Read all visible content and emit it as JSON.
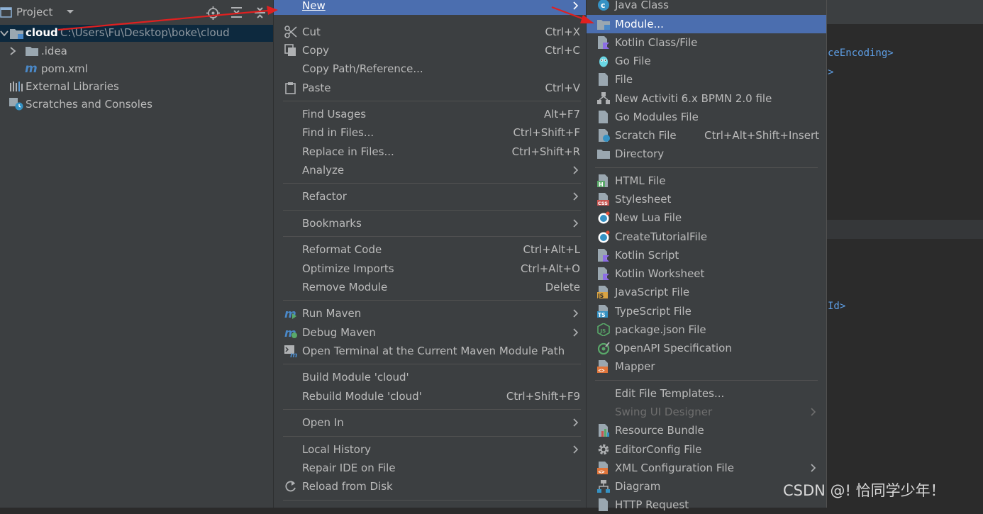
{
  "project_panel": {
    "title": "Project",
    "tree": {
      "root_name": "cloud",
      "root_path": "C:\\Users\\Fu\\Desktop\\boke\\cloud",
      "idea_folder": ".idea",
      "pom_file": "pom.xml",
      "external_libraries": "External Libraries",
      "scratches": "Scratches and Consoles"
    }
  },
  "editor": {
    "line1": "ceEncoding>",
    "line2": ">",
    "line3": "Id>"
  },
  "context_menu": {
    "new_label": "New",
    "cut": {
      "label": "Cut",
      "shortcut": "Ctrl+X"
    },
    "copy": {
      "label": "Copy",
      "shortcut": "Ctrl+C"
    },
    "copy_path": {
      "label": "Copy Path/Reference..."
    },
    "paste": {
      "label": "Paste",
      "shortcut": "Ctrl+V"
    },
    "find_usages": {
      "label": "Find Usages",
      "shortcut": "Alt+F7"
    },
    "find_in_files": {
      "label": "Find in Files...",
      "shortcut": "Ctrl+Shift+F"
    },
    "replace_in_files": {
      "label": "Replace in Files...",
      "shortcut": "Ctrl+Shift+R"
    },
    "analyze": {
      "label": "Analyze"
    },
    "refactor": {
      "label": "Refactor"
    },
    "bookmarks": {
      "label": "Bookmarks"
    },
    "reformat_code": {
      "label": "Reformat Code",
      "shortcut": "Ctrl+Alt+L"
    },
    "optimize_imports": {
      "label": "Optimize Imports",
      "shortcut": "Ctrl+Alt+O"
    },
    "remove_module": {
      "label": "Remove Module",
      "shortcut": "Delete"
    },
    "run_maven": {
      "label": "Run Maven"
    },
    "debug_maven": {
      "label": "Debug Maven"
    },
    "open_terminal": {
      "label": "Open Terminal at the Current Maven Module Path"
    },
    "build_module": {
      "label": "Build Module 'cloud'"
    },
    "rebuild_module": {
      "label": "Rebuild Module 'cloud'",
      "shortcut": "Ctrl+Shift+F9"
    },
    "open_in": {
      "label": "Open In"
    },
    "local_history": {
      "label": "Local History"
    },
    "repair_ide": {
      "label": "Repair IDE on File"
    },
    "reload_disk": {
      "label": "Reload from Disk"
    }
  },
  "new_submenu": {
    "java_class": "Java Class",
    "module": "Module...",
    "kotlin_class": "Kotlin Class/File",
    "go_file": "Go File",
    "file": "File",
    "activiti": "New Activiti 6.x BPMN 2.0 file",
    "go_modules": "Go Modules File",
    "scratch_file": "Scratch File",
    "scratch_shortcut": "Ctrl+Alt+Shift+Insert",
    "directory": "Directory",
    "html_file": "HTML File",
    "stylesheet": "Stylesheet",
    "lua_file": "New Lua File",
    "tutorial": "CreateTutorialFile",
    "kotlin_script": "Kotlin Script",
    "kotlin_worksheet": "Kotlin Worksheet",
    "javascript": "JavaScript File",
    "typescript": "TypeScript File",
    "package_json": "package.json File",
    "openapi": "OpenAPI Specification",
    "mapper": "Mapper",
    "edit_templates": "Edit File Templates...",
    "swing_designer": "Swing UI Designer",
    "resource_bundle": "Resource Bundle",
    "editorconfig": "EditorConfig File",
    "xml_config": "XML Configuration File",
    "diagram": "Diagram",
    "http_request": "HTTP Request"
  },
  "watermark": "CSDN @! 恰同学少年！",
  "colors": {
    "menu_bg": "#3c3f41",
    "highlight": "#4b6eaf",
    "annotation_arrow": "#e02020"
  }
}
